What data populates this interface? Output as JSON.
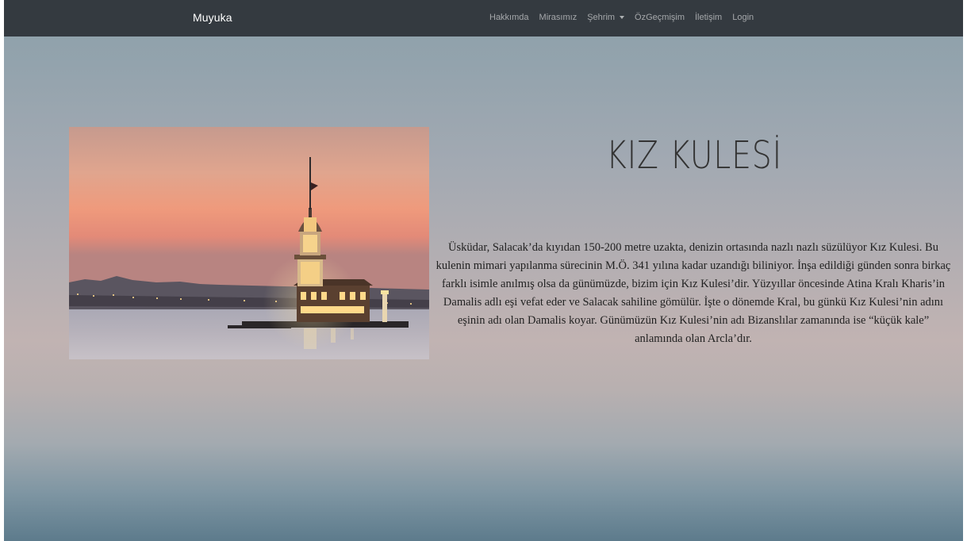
{
  "navbar": {
    "brand": "Muyuka",
    "links": {
      "about": "Hakkımda",
      "heritage": "Mirasımız",
      "city": "Şehrim",
      "cv": "ÖzGeçmişim",
      "contact": "İletişim",
      "login": "Login"
    }
  },
  "icons": {
    "city_dropdown": "caret-down-icon"
  },
  "colors": {
    "navbar_bg": "#343a40",
    "brand_text": "#ffffff",
    "nav_link_text": "#9a9da0",
    "body_text": "#222222",
    "heading_text": "#333333"
  },
  "main": {
    "title": "KIZ KULESİ",
    "paragraph": "Üsküdar, Salacak’da kıyıdan 150-200 metre uzakta, denizin ortasında nazlı nazlı süzülüyor Kız Kulesi. Bu kulenin mimari yapılanma sürecinin M.Ö. 341 yılına kadar uzandığı biliniyor. İnşa edildiği günden sonra birkaç farklı isimle anılmış olsa da günümüzde, bizim için Kız Kulesi’dir. Yüzyıllar öncesinde Atina Kralı Kharis’in Damalis adlı eşi vefat eder ve Salacak sahiline gömülür. İşte o dönemde Kral, bu günkü Kız Kulesi’nin adını eşinin adı olan Damalis koyar. Günümüzün Kız Kulesi’nin adı Bizanslılar zamanında ise “küçük kale” anlamında olan Arcla’dır."
  }
}
